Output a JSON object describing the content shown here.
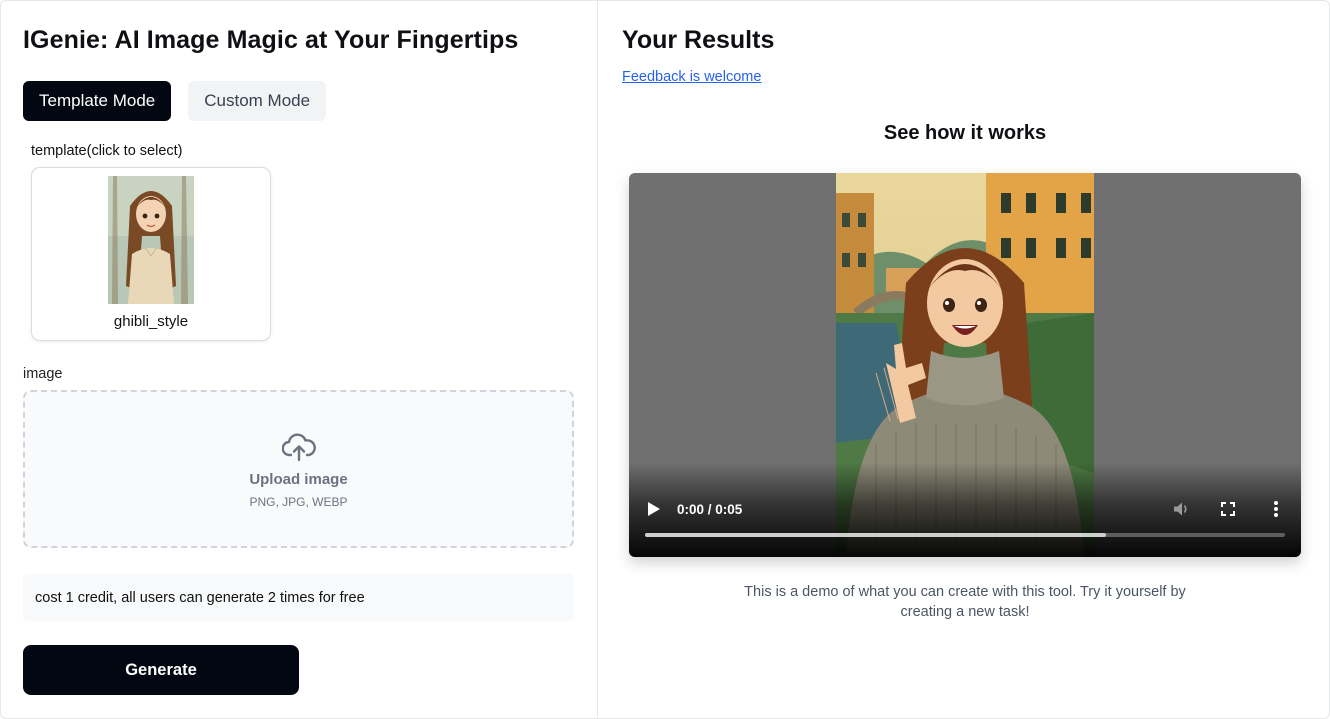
{
  "app": {
    "title": "IGenie: AI Image Magic at Your Fingertips"
  },
  "mode_tabs": [
    {
      "label": "Template Mode",
      "active": true
    },
    {
      "label": "Custom Mode",
      "active": false
    }
  ],
  "template": {
    "label": "template(click to select)",
    "items": [
      {
        "name": "ghibli_style"
      }
    ]
  },
  "image_upload": {
    "label": "image",
    "title": "Upload image",
    "formats": "PNG, JPG, WEBP",
    "icon": "cloud-upload-icon"
  },
  "cost_note": "cost 1 credit, all users can generate 2 times for free",
  "generate_label": "Generate",
  "results": {
    "title": "Your Results",
    "feedback_link": "Feedback is welcome",
    "demo_heading": "See how it works",
    "demo_description": "This is a demo of what you can create with this tool. Try it yourself by creating a new task!"
  },
  "video_player": {
    "time_display": "0:00 / 0:05",
    "buffered_fraction": 0.72,
    "icons": [
      "play-icon",
      "volume-icon",
      "fullscreen-icon",
      "more-vert-icon"
    ]
  },
  "colors": {
    "primary": "#030712",
    "link": "#2563eb",
    "muted_text": "#6b7280"
  }
}
